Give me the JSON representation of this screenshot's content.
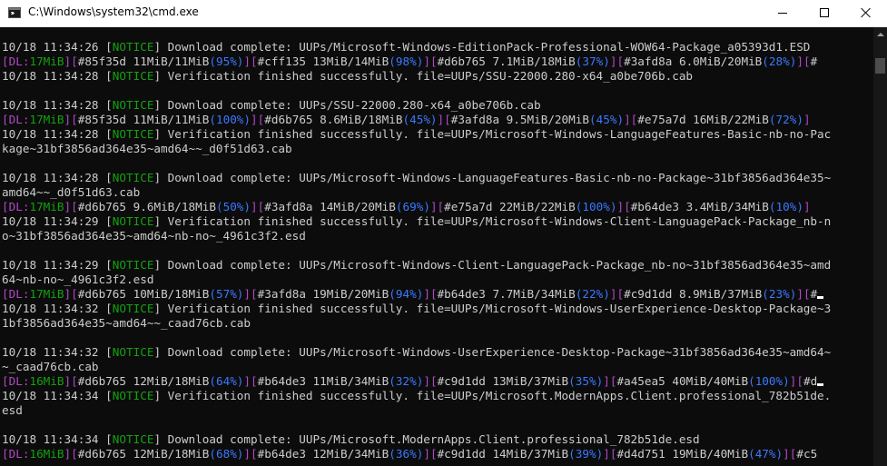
{
  "window": {
    "title": "C:\\Windows\\system32\\cmd.exe",
    "icons": {
      "app": "console-window-icon",
      "minimize": "minimize-icon",
      "maximize": "maximize-icon",
      "close": "close-icon",
      "scroll_up": "chevron-up-icon"
    }
  },
  "colors": {
    "background": "#0c0c0c",
    "text": "#cccccc",
    "notice": "#13a10e",
    "download_speed": "#13a10e",
    "percent": "#3b78ff",
    "bracket": "#b148c6"
  },
  "console": {
    "lines": [
      [
        [
          "t",
          "10/18 11:34:26 ["
        ],
        [
          "g",
          "NOTICE"
        ],
        [
          "t",
          "] Download complete: UUPs/Microsoft-Windows-EditionPack-Professional-WOW64-Package_a05393d1.ESD"
        ]
      ],
      [
        [
          "p",
          "[DL:"
        ],
        [
          "g",
          "17MiB"
        ],
        [
          "p",
          "]["
        ],
        [
          "t",
          "#85f35d 11MiB/11MiB"
        ],
        [
          "b",
          "(95%)"
        ],
        [
          "p",
          "]["
        ],
        [
          "t",
          "#cff135 13MiB/14MiB"
        ],
        [
          "b",
          "(98%)"
        ],
        [
          "p",
          "]["
        ],
        [
          "t",
          "#d6b765 7.1MiB/18MiB"
        ],
        [
          "b",
          "(37%)"
        ],
        [
          "p",
          "]["
        ],
        [
          "t",
          "#3afd8a 6.0MiB/20MiB"
        ],
        [
          "b",
          "(28%)"
        ],
        [
          "p",
          "]["
        ],
        [
          "t",
          "#"
        ]
      ],
      [
        [
          "t",
          "10/18 11:34:28 ["
        ],
        [
          "g",
          "NOTICE"
        ],
        [
          "t",
          "] Verification finished successfully. file=UUPs/SSU-22000.280-x64_a0be706b.cab"
        ]
      ],
      [
        [
          "t",
          ""
        ]
      ],
      [
        [
          "t",
          "10/18 11:34:28 ["
        ],
        [
          "g",
          "NOTICE"
        ],
        [
          "t",
          "] Download complete: UUPs/SSU-22000.280-x64_a0be706b.cab"
        ]
      ],
      [
        [
          "p",
          "[DL:"
        ],
        [
          "g",
          "17MiB"
        ],
        [
          "p",
          "]["
        ],
        [
          "t",
          "#85f35d 11MiB/11MiB"
        ],
        [
          "b",
          "(100%)"
        ],
        [
          "p",
          "]["
        ],
        [
          "t",
          "#d6b765 8.6MiB/18MiB"
        ],
        [
          "b",
          "(45%)"
        ],
        [
          "p",
          "]["
        ],
        [
          "t",
          "#3afd8a 9.5MiB/20MiB"
        ],
        [
          "b",
          "(45%)"
        ],
        [
          "p",
          "]["
        ],
        [
          "t",
          "#e75a7d 16MiB/22MiB"
        ],
        [
          "b",
          "(72%)"
        ],
        [
          "p",
          "]"
        ]
      ],
      [
        [
          "t",
          "10/18 11:34:28 ["
        ],
        [
          "g",
          "NOTICE"
        ],
        [
          "t",
          "] Verification finished successfully. file=UUPs/Microsoft-Windows-LanguageFeatures-Basic-nb-no-Pac"
        ]
      ],
      [
        [
          "t",
          "kage~31bf3856ad364e35~amd64~~_d0f51d63.cab"
        ]
      ],
      [
        [
          "t",
          ""
        ]
      ],
      [
        [
          "t",
          "10/18 11:34:28 ["
        ],
        [
          "g",
          "NOTICE"
        ],
        [
          "t",
          "] Download complete: UUPs/Microsoft-Windows-LanguageFeatures-Basic-nb-no-Package~31bf3856ad364e35~"
        ]
      ],
      [
        [
          "t",
          "amd64~~_d0f51d63.cab"
        ]
      ],
      [
        [
          "p",
          "[DL:"
        ],
        [
          "g",
          "17MiB"
        ],
        [
          "p",
          "]["
        ],
        [
          "t",
          "#d6b765 9.6MiB/18MiB"
        ],
        [
          "b",
          "(50%)"
        ],
        [
          "p",
          "]["
        ],
        [
          "t",
          "#3afd8a 14MiB/20MiB"
        ],
        [
          "b",
          "(69%)"
        ],
        [
          "p",
          "]["
        ],
        [
          "t",
          "#e75a7d 22MiB/22MiB"
        ],
        [
          "b",
          "(100%)"
        ],
        [
          "p",
          "]["
        ],
        [
          "t",
          "#b64de3 3.4MiB/34MiB"
        ],
        [
          "b",
          "(10%)"
        ],
        [
          "p",
          "]"
        ]
      ],
      [
        [
          "t",
          "10/18 11:34:29 ["
        ],
        [
          "g",
          "NOTICE"
        ],
        [
          "t",
          "] Verification finished successfully. file=UUPs/Microsoft-Windows-Client-LanguagePack-Package_nb-n"
        ]
      ],
      [
        [
          "t",
          "o~31bf3856ad364e35~amd64~nb-no~_4961c3f2.esd"
        ]
      ],
      [
        [
          "t",
          ""
        ]
      ],
      [
        [
          "t",
          "10/18 11:34:29 ["
        ],
        [
          "g",
          "NOTICE"
        ],
        [
          "t",
          "] Download complete: UUPs/Microsoft-Windows-Client-LanguagePack-Package_nb-no~31bf3856ad364e35~amd"
        ]
      ],
      [
        [
          "t",
          "64~nb-no~_4961c3f2.esd"
        ]
      ],
      [
        [
          "p",
          "[DL:"
        ],
        [
          "g",
          "17MiB"
        ],
        [
          "p",
          "]["
        ],
        [
          "t",
          "#d6b765 10MiB/18MiB"
        ],
        [
          "b",
          "(57%)"
        ],
        [
          "p",
          "]["
        ],
        [
          "t",
          "#3afd8a 19MiB/20MiB"
        ],
        [
          "b",
          "(94%)"
        ],
        [
          "p",
          "]["
        ],
        [
          "t",
          "#b64de3 7.7MiB/34MiB"
        ],
        [
          "b",
          "(22%)"
        ],
        [
          "p",
          "]["
        ],
        [
          "t",
          "#c9d1dd 8.9MiB/37MiB"
        ],
        [
          "b",
          "(23%)"
        ],
        [
          "p",
          "]["
        ],
        [
          "t",
          "#"
        ],
        [
          "c",
          ""
        ]
      ],
      [
        [
          "t",
          "10/18 11:34:32 ["
        ],
        [
          "g",
          "NOTICE"
        ],
        [
          "t",
          "] Verification finished successfully. file=UUPs/Microsoft-Windows-UserExperience-Desktop-Package~3"
        ]
      ],
      [
        [
          "t",
          "1bf3856ad364e35~amd64~~_caad76cb.cab"
        ]
      ],
      [
        [
          "t",
          ""
        ]
      ],
      [
        [
          "t",
          "10/18 11:34:32 ["
        ],
        [
          "g",
          "NOTICE"
        ],
        [
          "t",
          "] Download complete: UUPs/Microsoft-Windows-UserExperience-Desktop-Package~31bf3856ad364e35~amd64~"
        ]
      ],
      [
        [
          "t",
          "~_caad76cb.cab"
        ]
      ],
      [
        [
          "p",
          "[DL:"
        ],
        [
          "g",
          "16MiB"
        ],
        [
          "p",
          "]["
        ],
        [
          "t",
          "#d6b765 12MiB/18MiB"
        ],
        [
          "b",
          "(64%)"
        ],
        [
          "p",
          "]["
        ],
        [
          "t",
          "#b64de3 11MiB/34MiB"
        ],
        [
          "b",
          "(32%)"
        ],
        [
          "p",
          "]["
        ],
        [
          "t",
          "#c9d1dd 13MiB/37MiB"
        ],
        [
          "b",
          "(35%)"
        ],
        [
          "p",
          "]["
        ],
        [
          "t",
          "#a45ea5 40MiB/40MiB"
        ],
        [
          "b",
          "(100%)"
        ],
        [
          "p",
          "]["
        ],
        [
          "t",
          "#d"
        ],
        [
          "c",
          ""
        ]
      ],
      [
        [
          "t",
          "10/18 11:34:34 ["
        ],
        [
          "g",
          "NOTICE"
        ],
        [
          "t",
          "] Verification finished successfully. file=UUPs/Microsoft.ModernApps.Client.professional_782b51de."
        ]
      ],
      [
        [
          "t",
          "esd"
        ]
      ],
      [
        [
          "t",
          ""
        ]
      ],
      [
        [
          "t",
          "10/18 11:34:34 ["
        ],
        [
          "g",
          "NOTICE"
        ],
        [
          "t",
          "] Download complete: UUPs/Microsoft.ModernApps.Client.professional_782b51de.esd"
        ]
      ],
      [
        [
          "p",
          "[DL:"
        ],
        [
          "g",
          "16MiB"
        ],
        [
          "p",
          "]["
        ],
        [
          "t",
          "#d6b765 12MiB/18MiB"
        ],
        [
          "b",
          "(68%)"
        ],
        [
          "p",
          "]["
        ],
        [
          "t",
          "#b64de3 12MiB/34MiB"
        ],
        [
          "b",
          "(36%)"
        ],
        [
          "p",
          "]["
        ],
        [
          "t",
          "#c9d1dd 14MiB/37MiB"
        ],
        [
          "b",
          "(39%)"
        ],
        [
          "p",
          "]["
        ],
        [
          "t",
          "#d4d751 19MiB/40MiB"
        ],
        [
          "b",
          "(47%)"
        ],
        [
          "p",
          "]["
        ],
        [
          "t",
          "#c5"
        ]
      ]
    ]
  }
}
